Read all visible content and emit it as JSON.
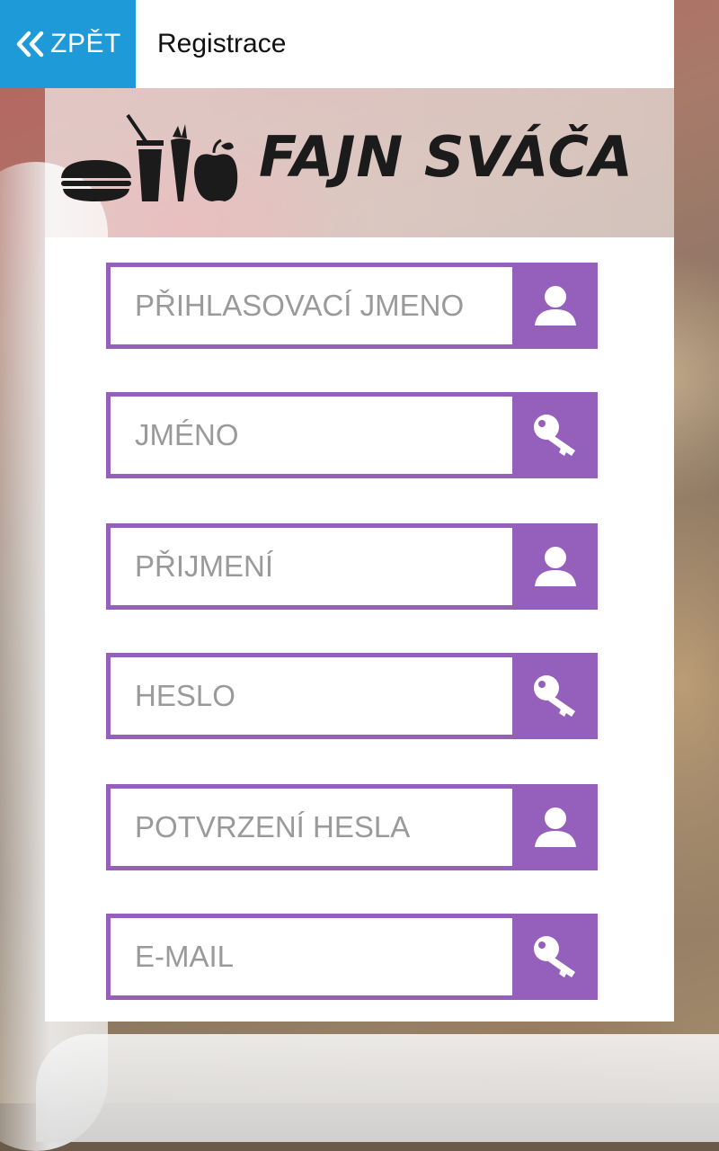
{
  "header": {
    "back_label": "ZPĚT",
    "title": "Registrace"
  },
  "brand": {
    "name": "FAJN SVÁČA"
  },
  "colors": {
    "back_button": "#1e9ad9",
    "field_accent": "#9560bb"
  },
  "form": {
    "fields": [
      {
        "placeholder": "PŘIHLASOVACÍ JMENO",
        "icon": "user-icon"
      },
      {
        "placeholder": "JMÉNO",
        "icon": "key-icon"
      },
      {
        "placeholder": "PŘIJMENÍ",
        "icon": "user-icon"
      },
      {
        "placeholder": "HESLO",
        "icon": "key-icon"
      },
      {
        "placeholder": "POTVRZENÍ HESLA",
        "icon": "user-icon"
      },
      {
        "placeholder": "E-MAIL",
        "icon": "key-icon"
      }
    ]
  }
}
